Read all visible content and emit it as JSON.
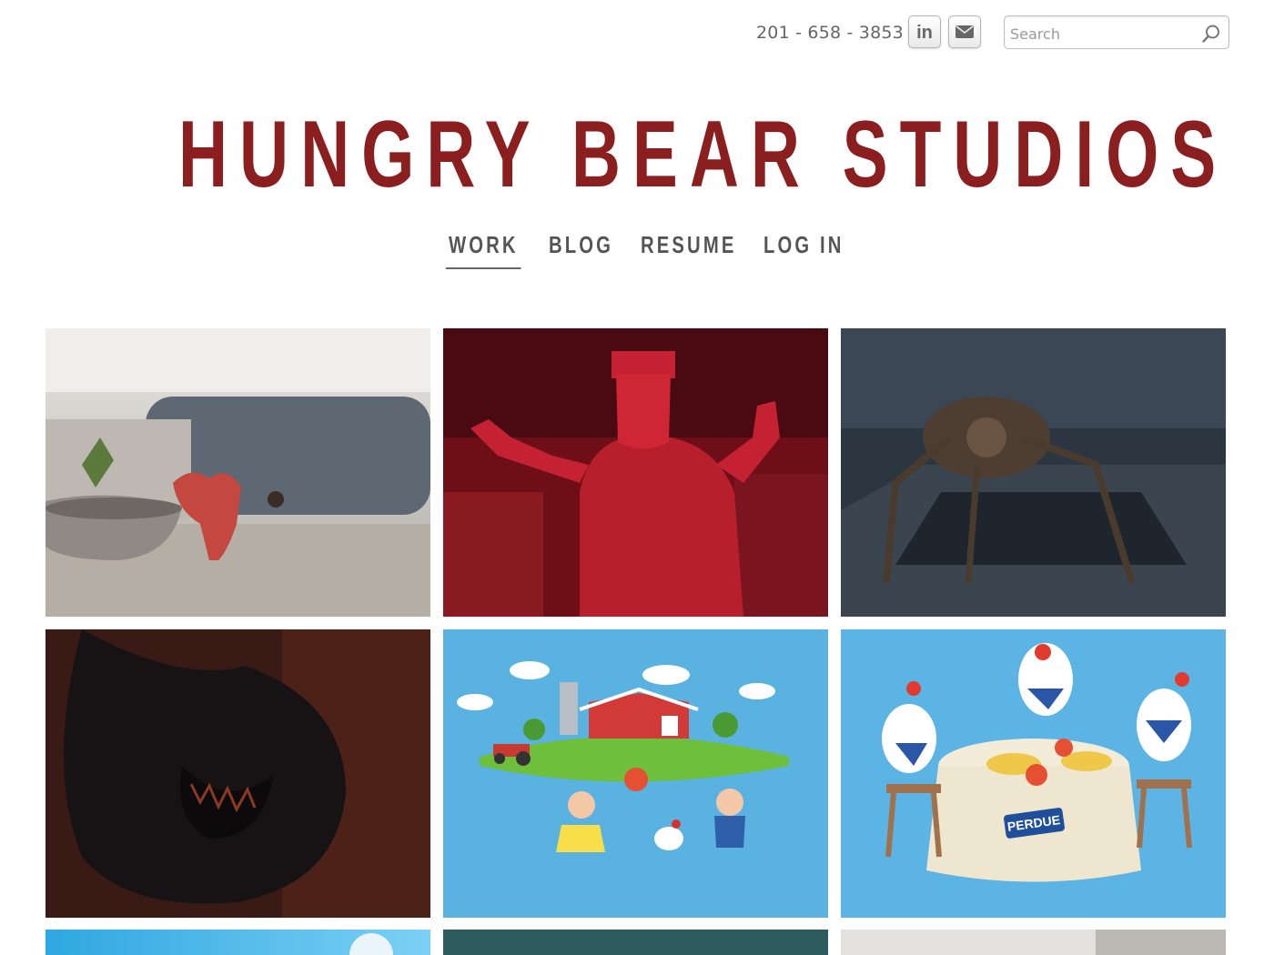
{
  "header": {
    "phone": "201 - 658 - 3853",
    "social": [
      {
        "icon": "linkedin-icon",
        "label": "in"
      },
      {
        "icon": "mail-icon"
      }
    ],
    "search": {
      "placeholder": "Search",
      "value": ""
    }
  },
  "logo": {
    "text": "HUNGRY BEAR STUDIOS",
    "color": "#8b1e1e"
  },
  "nav": {
    "items": [
      {
        "label": "WORK",
        "active": true
      },
      {
        "label": "BLOG",
        "active": false
      },
      {
        "label": "RESUME",
        "active": false
      },
      {
        "label": "LOG IN",
        "active": false
      }
    ]
  },
  "gallery": {
    "tiles": [
      {
        "name": "origami-rooster-thumbnail"
      },
      {
        "name": "red-monster-thumbnail"
      },
      {
        "name": "demogorgon-thumbnail"
      },
      {
        "name": "dark-creature-thumbnail"
      },
      {
        "name": "farm-illustration-thumbnail"
      },
      {
        "name": "perdue-chickens-thumbnail",
        "brand_text": "PERDUE"
      },
      {
        "name": "blue-mail-thumbnail"
      },
      {
        "name": "teal-thumbnail"
      },
      {
        "name": "grey-thumbnail"
      }
    ]
  }
}
